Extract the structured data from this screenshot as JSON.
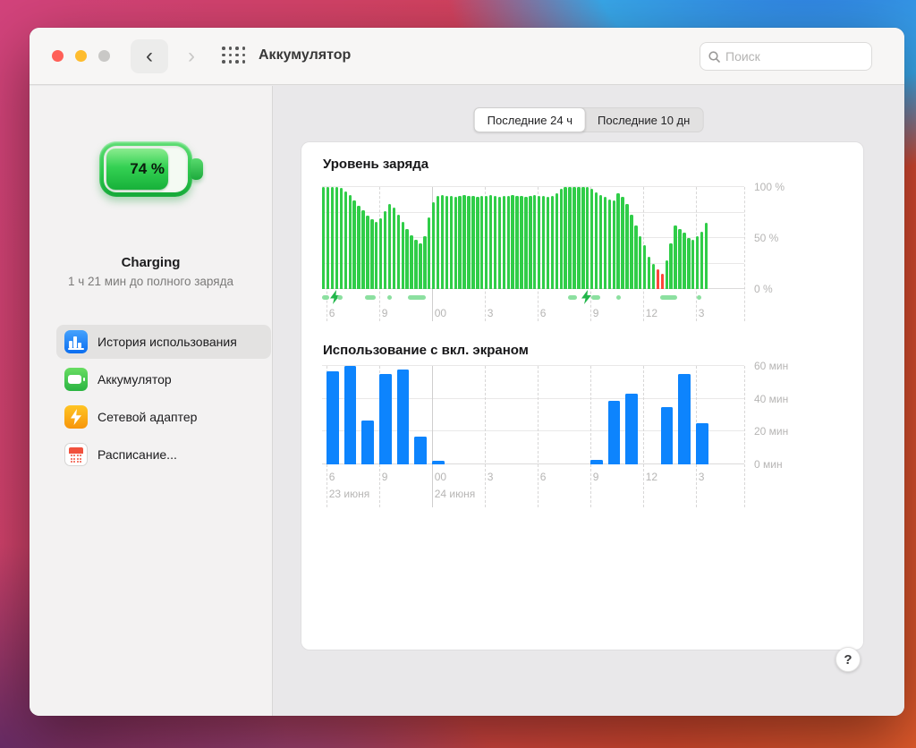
{
  "window": {
    "title": "Аккумулятор",
    "search_placeholder": "Поиск"
  },
  "toolbar": {
    "back_icon": "‹",
    "forward_icon": "›"
  },
  "tabs": [
    {
      "label": "Последние 24 ч",
      "selected": true
    },
    {
      "label": "Последние 10 дн",
      "selected": false
    }
  ],
  "sidebar": {
    "battery": {
      "percent_label": "74 %",
      "status": "Charging",
      "detail": "1 ч 21 мин до полного заряда"
    },
    "items": [
      {
        "label": "История использования",
        "icon": "usage-history-icon",
        "selected": true
      },
      {
        "label": "Аккумулятор",
        "icon": "battery-icon",
        "selected": false
      },
      {
        "label": "Сетевой адаптер",
        "icon": "power-adapter-icon",
        "selected": false
      },
      {
        "label": "Расписание...",
        "icon": "schedule-icon",
        "selected": false
      }
    ]
  },
  "help_label": "?",
  "colors": {
    "green_bar": "#30cd48",
    "red_bar": "#ff453a",
    "blue_bar": "#0d84fd",
    "strip_green": "#8ce0a0",
    "bolt_green": "#21b64a"
  },
  "chart_data": [
    {
      "type": "bar",
      "title": "Уровень заряда",
      "unit": "%",
      "start_time": "17:45",
      "step_minutes": 15,
      "ylim": [
        0,
        100
      ],
      "y_gridlines": [
        0,
        25,
        50,
        75,
        100
      ],
      "y_ticks": [
        {
          "label": "100 %",
          "value": 100
        },
        {
          "label": "50 %",
          "value": 50
        },
        {
          "label": "0 %",
          "value": 0
        }
      ],
      "x_ticks": [
        {
          "label": "6",
          "pct": 1.0
        },
        {
          "label": "9",
          "pct": 13.5
        },
        {
          "label": "00",
          "pct": 26.0,
          "solid": true
        },
        {
          "label": "3",
          "pct": 38.5
        },
        {
          "label": "6",
          "pct": 51.0
        },
        {
          "label": "9",
          "pct": 63.5
        },
        {
          "label": "12",
          "pct": 76.0
        },
        {
          "label": "3",
          "pct": 88.5
        }
      ],
      "values": [
        100,
        100,
        100,
        100,
        99,
        96,
        92,
        87,
        82,
        77,
        72,
        68,
        66,
        69,
        76,
        83,
        80,
        73,
        66,
        59,
        53,
        48,
        45,
        52,
        70,
        85,
        91,
        92,
        91,
        91,
        90,
        91,
        92,
        91,
        91,
        90,
        91,
        91,
        92,
        91,
        90,
        91,
        91,
        92,
        91,
        91,
        90,
        91,
        92,
        91,
        91,
        90,
        91,
        94,
        98,
        100,
        100,
        100,
        100,
        100,
        100,
        98,
        95,
        92,
        90,
        88,
        87,
        94,
        90,
        83,
        73,
        62,
        52,
        43,
        32,
        25,
        19,
        15,
        28,
        45,
        62,
        59,
        55,
        50,
        48,
        52,
        56,
        65
      ],
      "red_indices": [
        76,
        77
      ],
      "charging_strip": [
        {
          "type": "dash",
          "pct": 0.0,
          "w": 1.6
        },
        {
          "type": "bolt",
          "pct": 1.8
        },
        {
          "type": "dash",
          "pct": 3.5,
          "w": 1.4
        },
        {
          "type": "dash",
          "pct": 10.2,
          "w": 2.6
        },
        {
          "type": "dot",
          "pct": 15.4
        },
        {
          "type": "dash",
          "pct": 20.3,
          "w": 4.2
        },
        {
          "type": "dash",
          "pct": 58.2,
          "w": 2.2
        },
        {
          "type": "bolt",
          "pct": 61.3
        },
        {
          "type": "dash",
          "pct": 63.7,
          "w": 2.2
        },
        {
          "type": "dot",
          "pct": 69.8
        },
        {
          "type": "dash",
          "pct": 80.0,
          "w": 4.2
        },
        {
          "type": "dot",
          "pct": 88.8
        }
      ]
    },
    {
      "type": "bar",
      "title": "Использование с вкл. экраном",
      "unit": "мин",
      "start_hour": 18,
      "step_minutes": 60,
      "ylim": [
        0,
        60
      ],
      "y_gridlines": [
        0,
        20,
        40,
        60
      ],
      "y_ticks": [
        {
          "label": "60 мин",
          "value": 60
        },
        {
          "label": "40 мин",
          "value": 40
        },
        {
          "label": "20 мин",
          "value": 20
        },
        {
          "label": "0 мин",
          "value": 0
        }
      ],
      "x_ticks": [
        {
          "label": "6",
          "pct": 1.0
        },
        {
          "label": "9",
          "pct": 13.5
        },
        {
          "label": "00",
          "pct": 26.0,
          "solid": true
        },
        {
          "label": "3",
          "pct": 38.5
        },
        {
          "label": "6",
          "pct": 51.0
        },
        {
          "label": "9",
          "pct": 63.5
        },
        {
          "label": "12",
          "pct": 76.0
        },
        {
          "label": "3",
          "pct": 88.5
        }
      ],
      "values": [
        57,
        60,
        27,
        55,
        58,
        17,
        2,
        0,
        0,
        0,
        0,
        0,
        0,
        0,
        0,
        3,
        39,
        43,
        0,
        35,
        55,
        25,
        0,
        0
      ],
      "dates": [
        {
          "label": "23 июня",
          "pct": 1.0
        },
        {
          "label": "24 июня",
          "pct": 26.0
        }
      ]
    }
  ]
}
